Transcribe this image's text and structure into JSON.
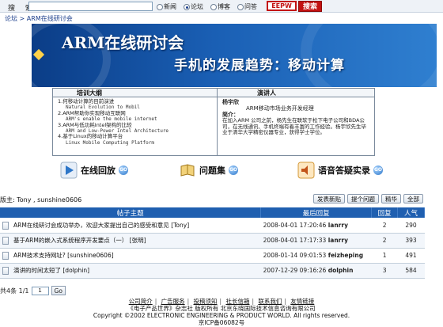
{
  "search": {
    "label": "搜 索:",
    "input_value": "",
    "radios": [
      {
        "label": "新闻",
        "checked": false
      },
      {
        "label": "论坛",
        "checked": true
      },
      {
        "label": "博客",
        "checked": false
      },
      {
        "label": "问答",
        "checked": false
      }
    ],
    "logo_text": "EEPW",
    "button_label": "搜索"
  },
  "breadcrumb": "论坛 > ARM在线研讨会",
  "banner": {
    "title": "ARM在线研讨会",
    "subtitle": "手机的发展趋势：移动计算"
  },
  "outline": {
    "heading": "培训大纲",
    "items": [
      {
        "cn": "1.何移动计算的目前演进",
        "en": "Natural Evolution to Mobil"
      },
      {
        "cn": "2.ARM帮助你实现移动互联网",
        "en": "ARM's enable the mobile internet"
      },
      {
        "cn": "3.ARM与低功耗Intel架构的比较",
        "en": "ARM and Low-Power Intel Architecture"
      },
      {
        "cn": "4.基于Linux的移动计算平台",
        "en": "Linux Mobile Computing Platform"
      }
    ]
  },
  "speaker": {
    "heading": "演讲人",
    "name": "杨宇欣",
    "role": "ARM移动市场业务开发经理",
    "intro_label": "简介：",
    "intro": "在加入ARM 公司之前，杨先生在联软于松下电子公司和BDA公司，在无线通讯、手机终端有着丰富的工作经验。杨宇欣先生毕业于清华大学精密仪器专业，获得学士学位。"
  },
  "actions": [
    {
      "label": "在线回放",
      "icon": "play-icon"
    },
    {
      "label": "问题集",
      "icon": "book-icon"
    },
    {
      "label": "语音答疑实录",
      "icon": "speaker-icon"
    }
  ],
  "moderators": "版主: Tony , sunshine0606",
  "buttons": [
    "发表新贴",
    "提个问题",
    "精华",
    "全部"
  ],
  "table": {
    "headers": [
      "帖子主题",
      "最后回复",
      "回复",
      "人气"
    ],
    "rows": [
      {
        "topic": "ARM在线研讨会成功举办，欢迎大家提出自己的感受和意见 [Tony]",
        "time": "2008-04-01 17:20:46",
        "user": "lanrry",
        "replies": "2",
        "views": "290"
      },
      {
        "topic": "基于ARM的嵌入式系统程序开发要点（一） [张明]",
        "time": "2008-04-01 17:17:33",
        "user": "lanrry",
        "replies": "2",
        "views": "393"
      },
      {
        "topic": "ARM技术支持网址? [sunshine0606]",
        "time": "2008-01-14 09:01:53",
        "user": "feizheping",
        "replies": "1",
        "views": "491"
      },
      {
        "topic": "演讲的时间太短了 [dolphin]",
        "time": "2007-12-29 09:16:26",
        "user": "dolphin",
        "replies": "3",
        "views": "584"
      }
    ]
  },
  "pager": {
    "summary": "共4条 1/1",
    "input_value": "1",
    "go_label": "Go"
  },
  "footer": {
    "links": [
      "公司简介",
      "广告服务",
      "投稿须知",
      "社长信箱",
      "联系我们",
      "友情链接"
    ],
    "line2": "《电子产品世界》杂志社 版权所有 北京东晓国际技术信息咨询有限公司",
    "line3": "Copyright ©2002 ELECTRONIC ENGINEERING & PRODUCT WORLD. All rights reserved.",
    "line4": "京ICP备06082号"
  }
}
